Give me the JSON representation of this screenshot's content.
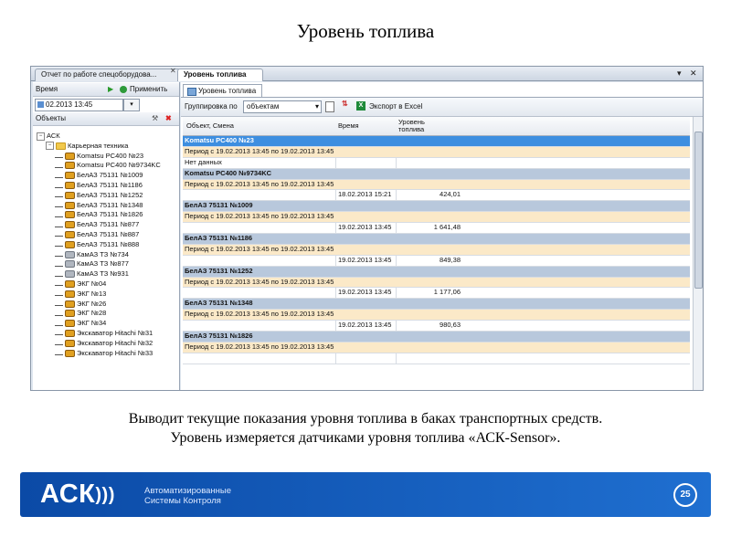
{
  "slide": {
    "title": "Уровень топлива",
    "caption_line1": "Выводит текущие показания уровня топлива в баках транспортных средств.",
    "caption_line2": "Уровень измеряется датчиками уровня топлива «АСК-Sensor»."
  },
  "tabs": [
    {
      "label": "Отчет по работе спецоборудова..."
    },
    {
      "label": "Уровень топлива"
    }
  ],
  "window_buttons": {
    "dropdown": "▾",
    "close": "✕"
  },
  "left_pane": {
    "time_label": "Время",
    "apply_label": "Применить",
    "date_value": "02.2013 13:45",
    "objects_label": "Объекты",
    "tree": [
      {
        "label": "АСК",
        "level": 0,
        "icon": "expand-minus"
      },
      {
        "label": "Карьерная техника",
        "level": 1,
        "icon": "folder"
      },
      {
        "label": "Komatsu PC400 №23",
        "level": 2,
        "icon": "excavator"
      },
      {
        "label": "Komatsu PC400 №9734KC",
        "level": 2,
        "icon": "excavator"
      },
      {
        "label": "БелАЗ 75131 №1009",
        "level": 2,
        "icon": "dump-truck"
      },
      {
        "label": "БелАЗ 75131 №1186",
        "level": 2,
        "icon": "dump-truck"
      },
      {
        "label": "БелАЗ 75131 №1252",
        "level": 2,
        "icon": "dump-truck"
      },
      {
        "label": "БелАЗ 75131 №1348",
        "level": 2,
        "icon": "dump-truck"
      },
      {
        "label": "БелАЗ 75131 №1826",
        "level": 2,
        "icon": "dump-truck"
      },
      {
        "label": "БелАЗ 75131 №877",
        "level": 2,
        "icon": "dump-truck"
      },
      {
        "label": "БелАЗ 75131 №887",
        "level": 2,
        "icon": "dump-truck"
      },
      {
        "label": "БелАЗ 75131 №888",
        "level": 2,
        "icon": "dump-truck"
      },
      {
        "label": "КамАЗ ТЗ №734",
        "level": 2,
        "icon": "tanker"
      },
      {
        "label": "КамАЗ ТЗ №877",
        "level": 2,
        "icon": "tanker"
      },
      {
        "label": "КамАЗ ТЗ №931",
        "level": 2,
        "icon": "tanker"
      },
      {
        "label": "ЭКГ №04",
        "level": 2,
        "icon": "excavator"
      },
      {
        "label": "ЭКГ №13",
        "level": 2,
        "icon": "excavator"
      },
      {
        "label": "ЭКГ №26",
        "level": 2,
        "icon": "excavator"
      },
      {
        "label": "ЭКГ №28",
        "level": 2,
        "icon": "excavator"
      },
      {
        "label": "ЭКГ №34",
        "level": 2,
        "icon": "excavator"
      },
      {
        "label": "Экскаватор Hitachi №31",
        "level": 2,
        "icon": "excavator"
      },
      {
        "label": "Экскаватор Hitachi №32",
        "level": 2,
        "icon": "excavator"
      },
      {
        "label": "Экскаватор Hitachi №33",
        "level": 2,
        "icon": "excavator"
      }
    ]
  },
  "right_pane": {
    "tab_label": "Уровень топлива",
    "group_by_label": "Группировка по",
    "group_by_value": "объектам",
    "export_label": "Экспорт в Excel",
    "columns": [
      "Объект, Смена",
      "Время",
      "Уровень топлива"
    ],
    "rows": [
      {
        "type": "obj",
        "selected": true,
        "c1": "Komatsu PC400 №23",
        "c2": "",
        "c3": ""
      },
      {
        "type": "period",
        "c1": "Период с 19.02.2013 13:45 по 19.02.2013 13:45",
        "c2": "",
        "c3": ""
      },
      {
        "type": "data",
        "c1": "Нет данных",
        "c2": "",
        "c3": ""
      },
      {
        "type": "obj",
        "c1": "Komatsu PC400 №9734KC",
        "c2": "",
        "c3": ""
      },
      {
        "type": "period",
        "c1": "Период с 19.02.2013 13:45 по 19.02.2013 13:45",
        "c2": "",
        "c3": ""
      },
      {
        "type": "data",
        "c1": "",
        "c2": "18.02.2013 15:21",
        "c3": "424,01"
      },
      {
        "type": "obj",
        "c1": "БелАЗ 75131 №1009",
        "c2": "",
        "c3": ""
      },
      {
        "type": "period",
        "c1": "Период с 19.02.2013 13:45 по 19.02.2013 13:45",
        "c2": "",
        "c3": ""
      },
      {
        "type": "data",
        "c1": "",
        "c2": "19.02.2013 13:45",
        "c3": "1 641,48"
      },
      {
        "type": "obj",
        "c1": "БелАЗ 75131 №1186",
        "c2": "",
        "c3": ""
      },
      {
        "type": "period",
        "c1": "Период с 19.02.2013 13:45 по 19.02.2013 13:45",
        "c2": "",
        "c3": ""
      },
      {
        "type": "data",
        "c1": "",
        "c2": "19.02.2013 13:45",
        "c3": "849,38"
      },
      {
        "type": "obj",
        "c1": "БелАЗ 75131 №1252",
        "c2": "",
        "c3": ""
      },
      {
        "type": "period",
        "c1": "Период с 19.02.2013 13:45 по 19.02.2013 13:45",
        "c2": "",
        "c3": ""
      },
      {
        "type": "data",
        "c1": "",
        "c2": "19.02.2013 13:45",
        "c3": "1 177,06"
      },
      {
        "type": "obj",
        "c1": "БелАЗ 75131 №1348",
        "c2": "",
        "c3": ""
      },
      {
        "type": "period",
        "c1": "Период с 19.02.2013 13:45 по 19.02.2013 13:45",
        "c2": "",
        "c3": ""
      },
      {
        "type": "data",
        "c1": "",
        "c2": "19.02.2013 13:45",
        "c3": "980,63"
      },
      {
        "type": "obj",
        "c1": "БелАЗ 75131 №1826",
        "c2": "",
        "c3": ""
      },
      {
        "type": "period",
        "c1": "Период с 19.02.2013 13:45 по 19.02.2013 13:45",
        "c2": "",
        "c3": ""
      },
      {
        "type": "data",
        "c1": "",
        "c2": "",
        "c3": ""
      }
    ]
  },
  "footer": {
    "logo": "АСК",
    "subtitle_line1": "Автоматизированные",
    "subtitle_line2": "Системы Контроля",
    "page_number": "25"
  },
  "colors": {
    "selected_row": "#3d8ee0",
    "object_row": "#b8c8dc",
    "period_row": "#fbe9c8",
    "footer_blue": "#1f6fd0"
  }
}
